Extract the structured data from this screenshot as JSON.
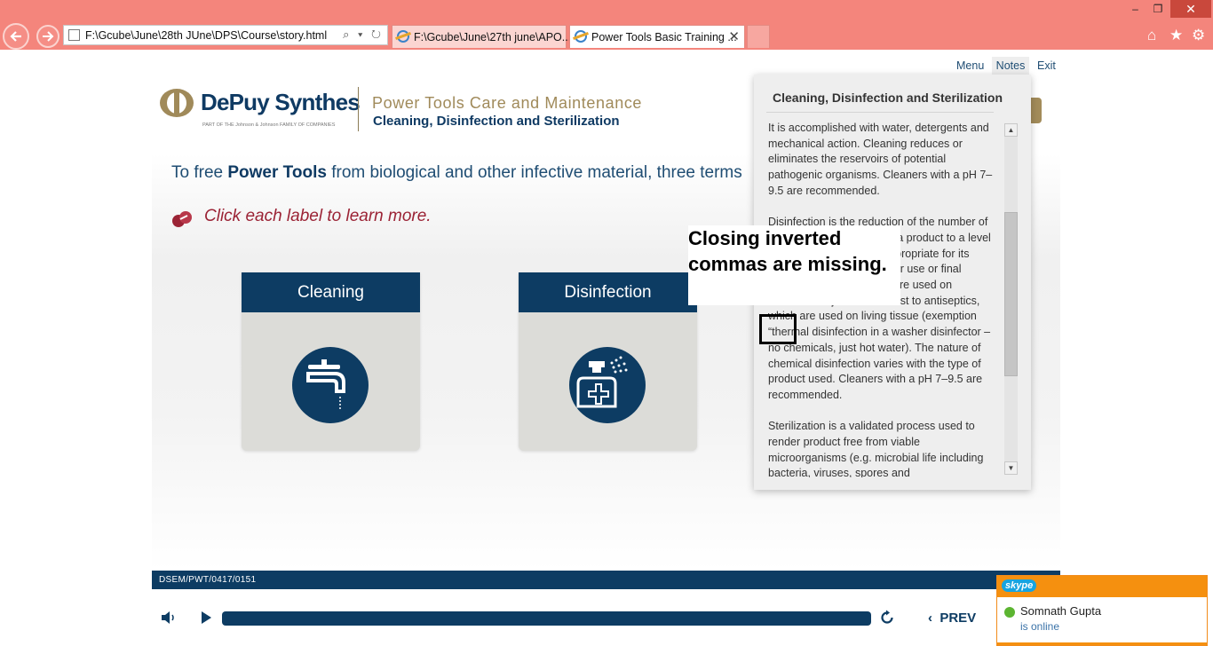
{
  "browser": {
    "address_url": "F:\\Gcube\\June\\28th JUne\\DPS\\Course\\story.html",
    "address_tools": "⌕ ▾ ↻",
    "tabs": [
      {
        "label": "F:\\Gcube\\June\\27th june\\APO..."
      },
      {
        "label": "Power Tools Basic Training ...",
        "close": "✕"
      }
    ],
    "window": {
      "minimize": "–",
      "maximize": "❐",
      "close": "✕"
    },
    "commands": {
      "home": "⌂",
      "favorites": "★",
      "tools": "⚙"
    }
  },
  "brand": {
    "name": "DePuy Synthes",
    "tagline": "PART OF THE Johnson & Johnson FAMILY OF COMPANIES"
  },
  "course": {
    "title": "Power Tools Care and Maintenance",
    "subtitle": "Cleaning, Disinfection and Sterilization"
  },
  "slide": {
    "intro_before": "To free ",
    "intro_bold": "Power Tools",
    "intro_after": " from biological and other infective material, three terms",
    "instruction": "Click each label to learn more.",
    "cards": [
      {
        "label": "Cleaning",
        "icon": "faucet-icon"
      },
      {
        "label": "Disinfection",
        "icon": "spray-bottle-icon"
      }
    ]
  },
  "player": {
    "reference_code": "DSEM/PWT/0417/0151",
    "prev_label": "PREV",
    "prev_arrow": "‹"
  },
  "top_links": {
    "menu": "Menu",
    "notes": "Notes",
    "exit": "Exit"
  },
  "notes": {
    "title": "Cleaning, Disinfection and Sterilization",
    "paragraphs": [
      "It is accomplished with water, detergents and mechanical action. Cleaning reduces or eliminates the reservoirs of potential pathogenic organisms. Cleaners with a pH 7–9.5 are recommended.",
      "Disinfection is the reduction of the number of viable microorganisms on a product to a level previously specified as appropriate for its intended further handling or use or final disposition. Disinfectants are used on inanimate objects in contrast to antiseptics, which are used on living tissue (exemption “thermal disinfection in a washer disinfector – no chemicals, just hot water). The nature of chemical disinfection varies with the type of product used. Cleaners with a pH 7–9.5 are recommended.",
      "Sterilization is a validated process used to render product free from viable microorganisms (e.g. microbial life including bacteria, viruses, spores and"
    ],
    "scroll_up": "▲",
    "scroll_down": "▼"
  },
  "annotation": {
    "text": "Closing inverted commas are missing."
  },
  "skype": {
    "logo": "skype",
    "contact": "Somnath Gupta",
    "status": "is online"
  },
  "colors": {
    "navy": "#0d3c63",
    "gold": "#a08a5a",
    "accent_red": "#9b2335",
    "chrome": "#f4857c",
    "skype_orange": "#f5900f"
  }
}
